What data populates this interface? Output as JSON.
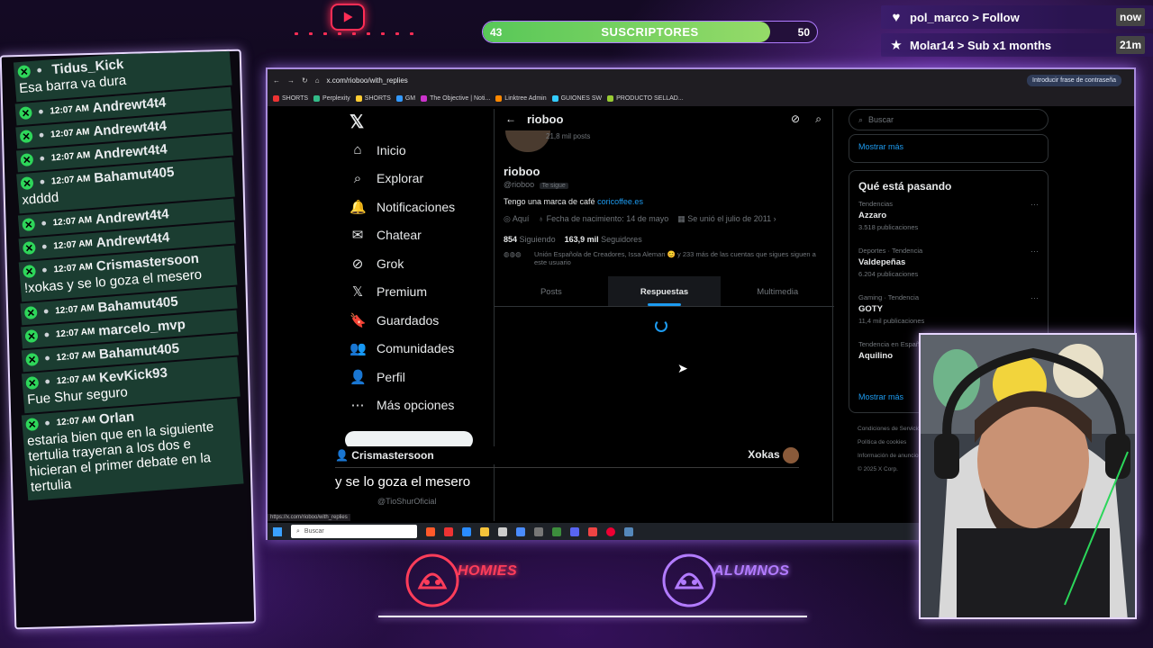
{
  "overlay": {
    "subs": {
      "label": "SUSCRIPTORES",
      "current": "43",
      "goal": "50",
      "progress": 0.86
    },
    "alerts": [
      {
        "icon": "heart-icon",
        "text": "pol_marco > Follow",
        "time": "now"
      },
      {
        "icon": "star-icon",
        "text": "Molar14 > Sub x1 months",
        "time": "21m"
      }
    ],
    "logos": {
      "left": "HOMIES",
      "right": "ALUMNOS"
    }
  },
  "chat": {
    "messages": [
      {
        "time": "",
        "user": "Tidus_Kick",
        "text": "Esa barra va dura"
      },
      {
        "time": "12:07 AM",
        "user": "Andrewt4t4",
        "text": ""
      },
      {
        "time": "12:07 AM",
        "user": "Andrewt4t4",
        "text": ""
      },
      {
        "time": "12:07 AM",
        "user": "Andrewt4t4",
        "text": ""
      },
      {
        "time": "12:07 AM",
        "user": "Bahamut405",
        "text": "xdddd"
      },
      {
        "time": "12:07 AM",
        "user": "Andrewt4t4",
        "text": ""
      },
      {
        "time": "12:07 AM",
        "user": "Andrewt4t4",
        "text": ""
      },
      {
        "time": "12:07 AM",
        "user": "Crismastersoon",
        "text": "!xokas y se lo goza el mesero"
      },
      {
        "time": "12:07 AM",
        "user": "Bahamut405",
        "text": ""
      },
      {
        "time": "12:07 AM",
        "user": "marcelo_mvp",
        "text": ""
      },
      {
        "time": "12:07 AM",
        "user": "Bahamut405",
        "text": ""
      },
      {
        "time": "12:07 AM",
        "user": "KevKick93",
        "text": "Fue Shur seguro"
      },
      {
        "time": "12:07 AM",
        "user": "Orlan",
        "text": "estaria bien que en la siguiente tertulia trayeran a los dos e hicieran el primer debate en la tertulia"
      }
    ]
  },
  "browser": {
    "url": "x.com/rioboo/with_replies",
    "password_button": "Introducir frase de contraseña",
    "bookmarks": [
      "SHORTS",
      "Perplexity",
      "SHORTS",
      "GM",
      "The Objective | Noti...",
      "Linktree Admin",
      "GUIONES SW",
      "PRODUCTO SELLAD..."
    ],
    "status_url": "https://x.com/rioboo/with_replies",
    "taskbar_search": "Buscar"
  },
  "x": {
    "nav": [
      "Inicio",
      "Explorar",
      "Notificaciones",
      "Chatear",
      "Grok",
      "Premium",
      "Guardados",
      "Comunidades",
      "Perfil",
      "Más opciones"
    ],
    "profile": {
      "header_name": "rioboo",
      "header_posts": "21,8 mil posts",
      "name": "rioboo",
      "handle": "@rioboo",
      "follows_you": "Te sigue",
      "bio": "Tengo una marca de café ",
      "bio_link": "coricoffee.es",
      "location": "Aquí",
      "birthday": "Fecha de nacimiento: 14 de mayo",
      "joined": "Se unió el julio de 2011",
      "following_count": "854",
      "following_label": "Siguiendo",
      "followers_count": "163,9 mil",
      "followers_label": "Seguidores",
      "followed_by": "Unión Española de Creadores, Issa Aleman 😊 y 233 más de las cuentas que sigues siguen a este usuario",
      "tabs": [
        "Posts",
        "Respuestas",
        "Multimedia"
      ],
      "active_tab": "Respuestas"
    },
    "sidebar": {
      "search_placeholder": "Buscar",
      "show_more": "Mostrar más",
      "trending_title": "Qué está pasando",
      "trends": [
        {
          "context": "Tendencias",
          "topic": "Azzaro",
          "count": "3.518 publicaciones"
        },
        {
          "context": "Deportes · Tendencia",
          "topic": "Valdepeñas",
          "count": "6.204 publicaciones"
        },
        {
          "context": "Gaming · Tendencia",
          "topic": "GOTY",
          "count": "11,4 mil publicaciones"
        },
        {
          "context": "Tendencia en España",
          "topic": "Aquilino",
          "count": ""
        }
      ],
      "show_more_2": "Mostrar más",
      "footer": [
        "Condiciones de Servicio",
        "Política de cookies",
        "Información de anuncios",
        "© 2025 X Corp."
      ]
    },
    "caption_bar": {
      "left": "Crismastersoon",
      "right": "Xokas"
    },
    "caption": "y se lo goza el mesero",
    "under_caption": "@TioShurOficial"
  }
}
